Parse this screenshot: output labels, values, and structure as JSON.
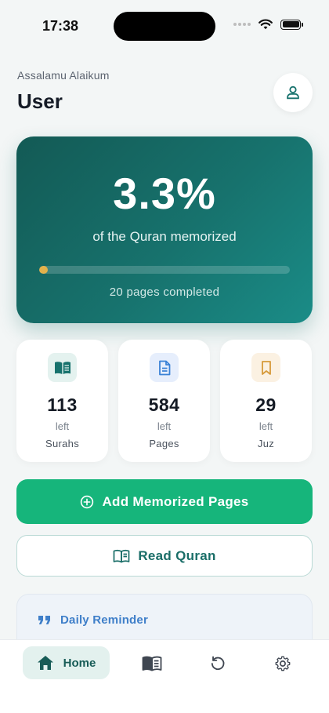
{
  "status_bar": {
    "time": "17:38"
  },
  "header": {
    "greeting": "Assalamu Alaikum",
    "user_name": "User"
  },
  "hero": {
    "percent": "3.3%",
    "caption": "of the Quran memorized",
    "progress_fraction": 0.033,
    "pages_completed": "20 pages completed"
  },
  "stats": [
    {
      "value": "113",
      "sub": "left",
      "label": "Surahs",
      "icon": "book-open-icon",
      "icon_color": "#17726d",
      "icon_bg": "#e4f2ef"
    },
    {
      "value": "584",
      "sub": "left",
      "label": "Pages",
      "icon": "document-icon",
      "icon_color": "#3b82d6",
      "icon_bg": "#e6eefc"
    },
    {
      "value": "29",
      "sub": "left",
      "label": "Juz",
      "icon": "bookmark-icon",
      "icon_color": "#d69a3a",
      "icon_bg": "#fbf1e2"
    }
  ],
  "actions": {
    "add_label": "Add Memorized Pages",
    "read_label": "Read Quran"
  },
  "reminder": {
    "title": "Daily Reminder"
  },
  "nav": {
    "home_label": "Home",
    "items": [
      "home-icon",
      "quran-book-icon",
      "history-icon",
      "settings-icon"
    ]
  },
  "colors": {
    "primary_green": "#16b57b",
    "teal_dark": "#135a55",
    "teal_light": "#1a8c87",
    "progress_gold": "#e2b24c",
    "reminder_blue": "#3f7fc9"
  }
}
